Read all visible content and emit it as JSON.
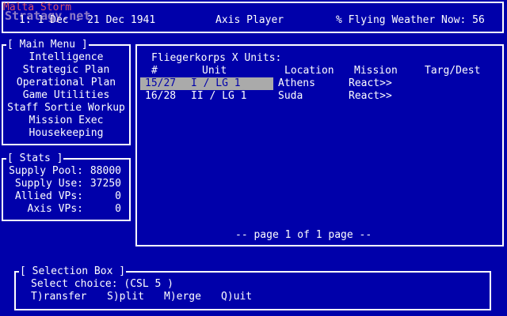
{
  "topbar": {
    "date_text": "1: 1 Dec - 21 Dec 1941",
    "player": "Axis Player",
    "weather": "% Flying Weather Now: 56",
    "watermark_line1": "Malta Storm",
    "watermark_line2": "Stratagy.net"
  },
  "main_menu": {
    "title": "[ Main Menu ]",
    "items": [
      "Intelligence",
      "Strategic Plan",
      "Operational Plan",
      "Game Utilities",
      "Staff Sortie Workup",
      "Mission Exec",
      "Housekeeping"
    ]
  },
  "stats": {
    "title": "[ Stats ]",
    "rows": [
      {
        "label": "Supply Pool:",
        "value": "88000"
      },
      {
        "label": "Supply Use:",
        "value": "37250"
      },
      {
        "label": "Allied VPs:",
        "value": "0"
      },
      {
        "label": "Axis VPs:",
        "value": "0"
      }
    ]
  },
  "units_panel": {
    "title": "Fliegerkorps X Units:",
    "columns": [
      "#",
      "Unit",
      "Location",
      "Mission",
      "Targ/Dest"
    ],
    "rows": [
      {
        "num": "15/27",
        "unit": "I / LG 1",
        "location": "Athens",
        "mission": "React>>",
        "target": "",
        "selected": true
      },
      {
        "num": "16/28",
        "unit": "II / LG 1",
        "location": "Suda",
        "mission": "React>>",
        "target": "",
        "selected": false
      }
    ],
    "page_text": "-- page 1 of 1 page --"
  },
  "selection_box": {
    "title": "[ Selection Box ]",
    "prompt": "Select choice: (CSL 5 )",
    "commands": [
      "T)ransfer",
      "S)plit",
      "M)erge",
      "Q)uit"
    ]
  },
  "colors": {
    "background": "#0000aa",
    "text": "#ffffff",
    "highlight": "#aaaaaa"
  }
}
